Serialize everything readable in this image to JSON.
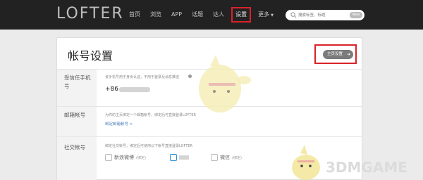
{
  "header": {
    "logo": "LOFTER",
    "nav": [
      {
        "label": "首页",
        "active": false
      },
      {
        "label": "浏览",
        "active": false
      },
      {
        "label": "APP",
        "active": false
      },
      {
        "label": "话题",
        "active": false
      },
      {
        "label": "达人",
        "active": false
      },
      {
        "label": "设置",
        "active": true
      },
      {
        "label": "更多",
        "active": false
      }
    ],
    "search": {
      "placeholder": "搜索标签、标题",
      "badge": "New"
    }
  },
  "page": {
    "title": "帐号设置",
    "home_button": "主页设置"
  },
  "sections": {
    "phone": {
      "label": "受信任手机号",
      "desc": "该手机号用于身份认证，不用于登录及消息推送",
      "country_code": "+86"
    },
    "email": {
      "label": "邮箱帐号",
      "desc": "为你的主页绑定一个邮箱帐号，绑定后可直接登录LOFTER",
      "link": "绑定邮箱帐号 >"
    },
    "social": {
      "label": "社交帐号",
      "desc": "绑定社交帐号，绑定后可使用以下帐号直接登录LOFTER",
      "accounts": [
        {
          "name": "新浪微博",
          "status": "(绑定)",
          "icon": "weibo-icon"
        },
        {
          "name": "QQ",
          "status": "",
          "icon": "qq-icon"
        },
        {
          "name": "微信",
          "status": "(绑定)",
          "icon": "wechat-icon"
        }
      ]
    }
  },
  "watermark": "3DMGAME",
  "colors": {
    "topbar": "#222222",
    "highlight": "#d8232a",
    "link": "#4a7db7"
  }
}
